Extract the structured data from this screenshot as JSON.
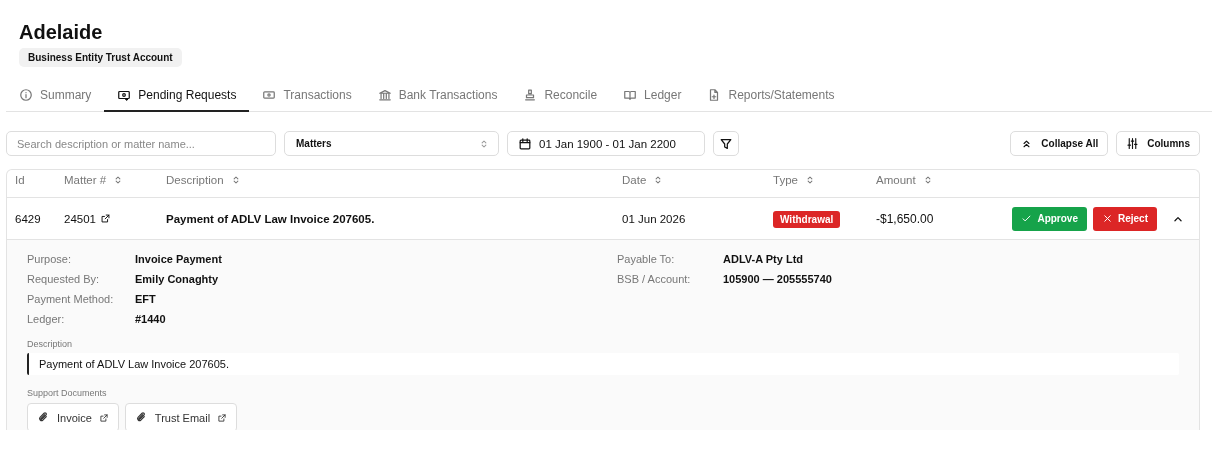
{
  "account": {
    "name": "Adelaide",
    "badge": "Business Entity Trust Account"
  },
  "tabs": [
    {
      "label": "Summary",
      "selected": false
    },
    {
      "label": "Pending Requests",
      "selected": true
    },
    {
      "label": "Transactions",
      "selected": false
    },
    {
      "label": "Bank Transactions",
      "selected": false
    },
    {
      "label": "Reconcile",
      "selected": false
    },
    {
      "label": "Ledger",
      "selected": false
    },
    {
      "label": "Reports/Statements",
      "selected": false
    }
  ],
  "toolbar": {
    "search": {
      "placeholder": "Search description or matter name..."
    },
    "matters_select": {
      "value": "Matters"
    },
    "date_range": "01 Jan 1900 - 01 Jan 2200",
    "buttons": [
      "Collapse All",
      "Columns"
    ]
  },
  "table": {
    "columns": [
      {
        "label": "Id",
        "sortable": false
      },
      {
        "label": "Matter #",
        "sortable": true
      },
      {
        "label": "Description",
        "sortable": true
      },
      {
        "label": "Date",
        "sortable": true
      },
      {
        "label": "Type",
        "sortable": true
      },
      {
        "label": "Amount",
        "sortable": true
      }
    ],
    "rows": [
      {
        "id": "6429",
        "matter": "24501",
        "description": "Payment of ADLV Law Invoice 207605.",
        "date": "01 Jun 2026",
        "type": {
          "label": "Withdrawal",
          "kind": "withdrawal"
        },
        "amount": "-$1,650.00",
        "actions": [
          "Approve",
          "Reject"
        ],
        "expanded": true,
        "details": {
          "left": [
            {
              "label": "Purpose:",
              "value": "Invoice Payment"
            },
            {
              "label": "Requested By:",
              "value": "Emily Conaghty"
            },
            {
              "label": "Payment Method:",
              "value": "EFT"
            },
            {
              "label": "Ledger:",
              "value": "#1440"
            }
          ],
          "right": [
            {
              "label": "Payable To:",
              "value": "ADLV-A Pty Ltd"
            },
            {
              "label": "BSB / Account:",
              "value": "105900 — 205555740"
            }
          ],
          "description_label": "Description",
          "description": "Payment of ADLV Law Invoice 207605.",
          "documents_label": "Support Documents",
          "documents": [
            "Invoice",
            "Trust Email"
          ]
        }
      }
    ]
  }
}
